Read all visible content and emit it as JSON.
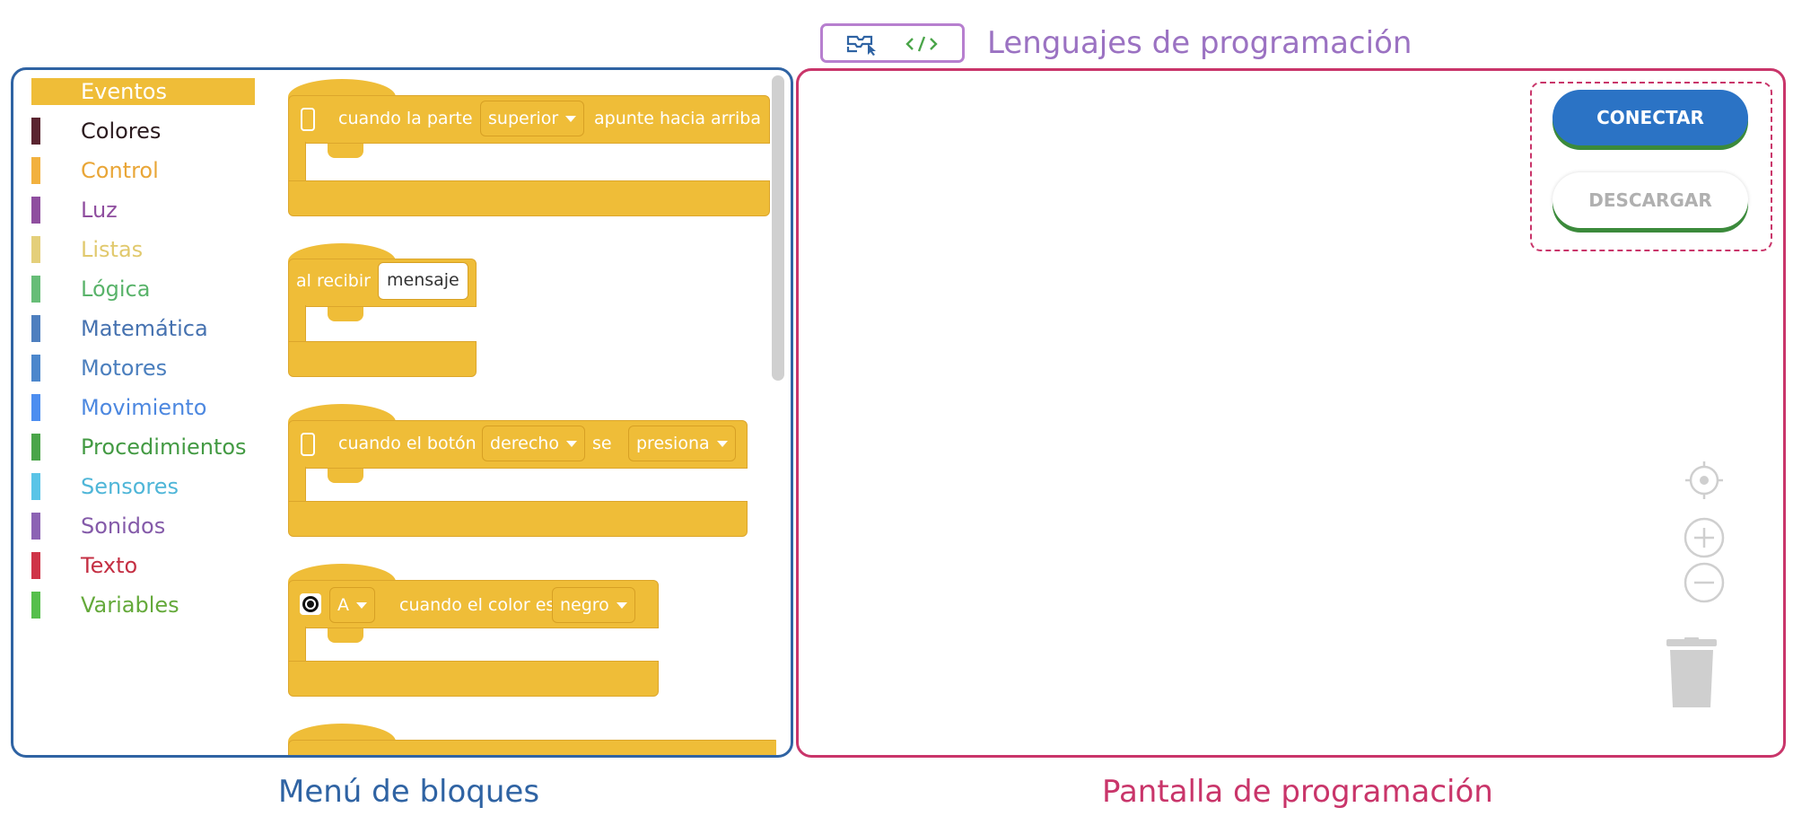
{
  "languages": {
    "title": "Lenguajes de programación",
    "icons": [
      "blocks-icon",
      "code-icon"
    ]
  },
  "menu": {
    "categories": [
      {
        "label": "Eventos",
        "color": "#efbd38",
        "text_color": "#ffffff",
        "active": true
      },
      {
        "label": "Colores",
        "color": "#5a2430",
        "text_color": "#2a1a1e"
      },
      {
        "label": "Control",
        "color": "#f2b13e",
        "text_color": "#e9a637"
      },
      {
        "label": "Luz",
        "color": "#8f4e9f",
        "text_color": "#8f4e9f"
      },
      {
        "label": "Listas",
        "color": "#e4cf7a",
        "text_color": "#e1c96d"
      },
      {
        "label": "Lógica",
        "color": "#67bd77",
        "text_color": "#59b36a"
      },
      {
        "label": "Matemática",
        "color": "#4e7fbf",
        "text_color": "#4672b0"
      },
      {
        "label": "Motores",
        "color": "#4c87cc",
        "text_color": "#4b7fbe"
      },
      {
        "label": "Movimiento",
        "color": "#4d8ef0",
        "text_color": "#4d88e0"
      },
      {
        "label": "Procedimientos",
        "color": "#4aa549",
        "text_color": "#439a43"
      },
      {
        "label": "Sensores",
        "color": "#5ac4e7",
        "text_color": "#4fb6d8"
      },
      {
        "label": "Sonidos",
        "color": "#8c63b4",
        "text_color": "#845aa9"
      },
      {
        "label": "Texto",
        "color": "#cf3448",
        "text_color": "#c42f43"
      },
      {
        "label": "Variables",
        "color": "#56bf4c",
        "text_color": "#64a93a"
      }
    ],
    "blocks": [
      {
        "prefix": "cuando la parte",
        "dropdown": "superior",
        "suffix": "apunte hacia arriba"
      },
      {
        "prefix": "al recibir",
        "field": "mensaje"
      },
      {
        "prefix": "cuando el botón",
        "dropdown1": "derecho",
        "middle": "se",
        "dropdown2": "presiona"
      },
      {
        "dropdown1": "A",
        "middle": "cuando el color es",
        "dropdown2": "negro"
      }
    ]
  },
  "screen": {
    "connect_label": "CONECTAR",
    "download_label": "DESCARGAR"
  },
  "captions": {
    "menu": "Menú de bloques",
    "screen": "Pantalla de programación"
  }
}
